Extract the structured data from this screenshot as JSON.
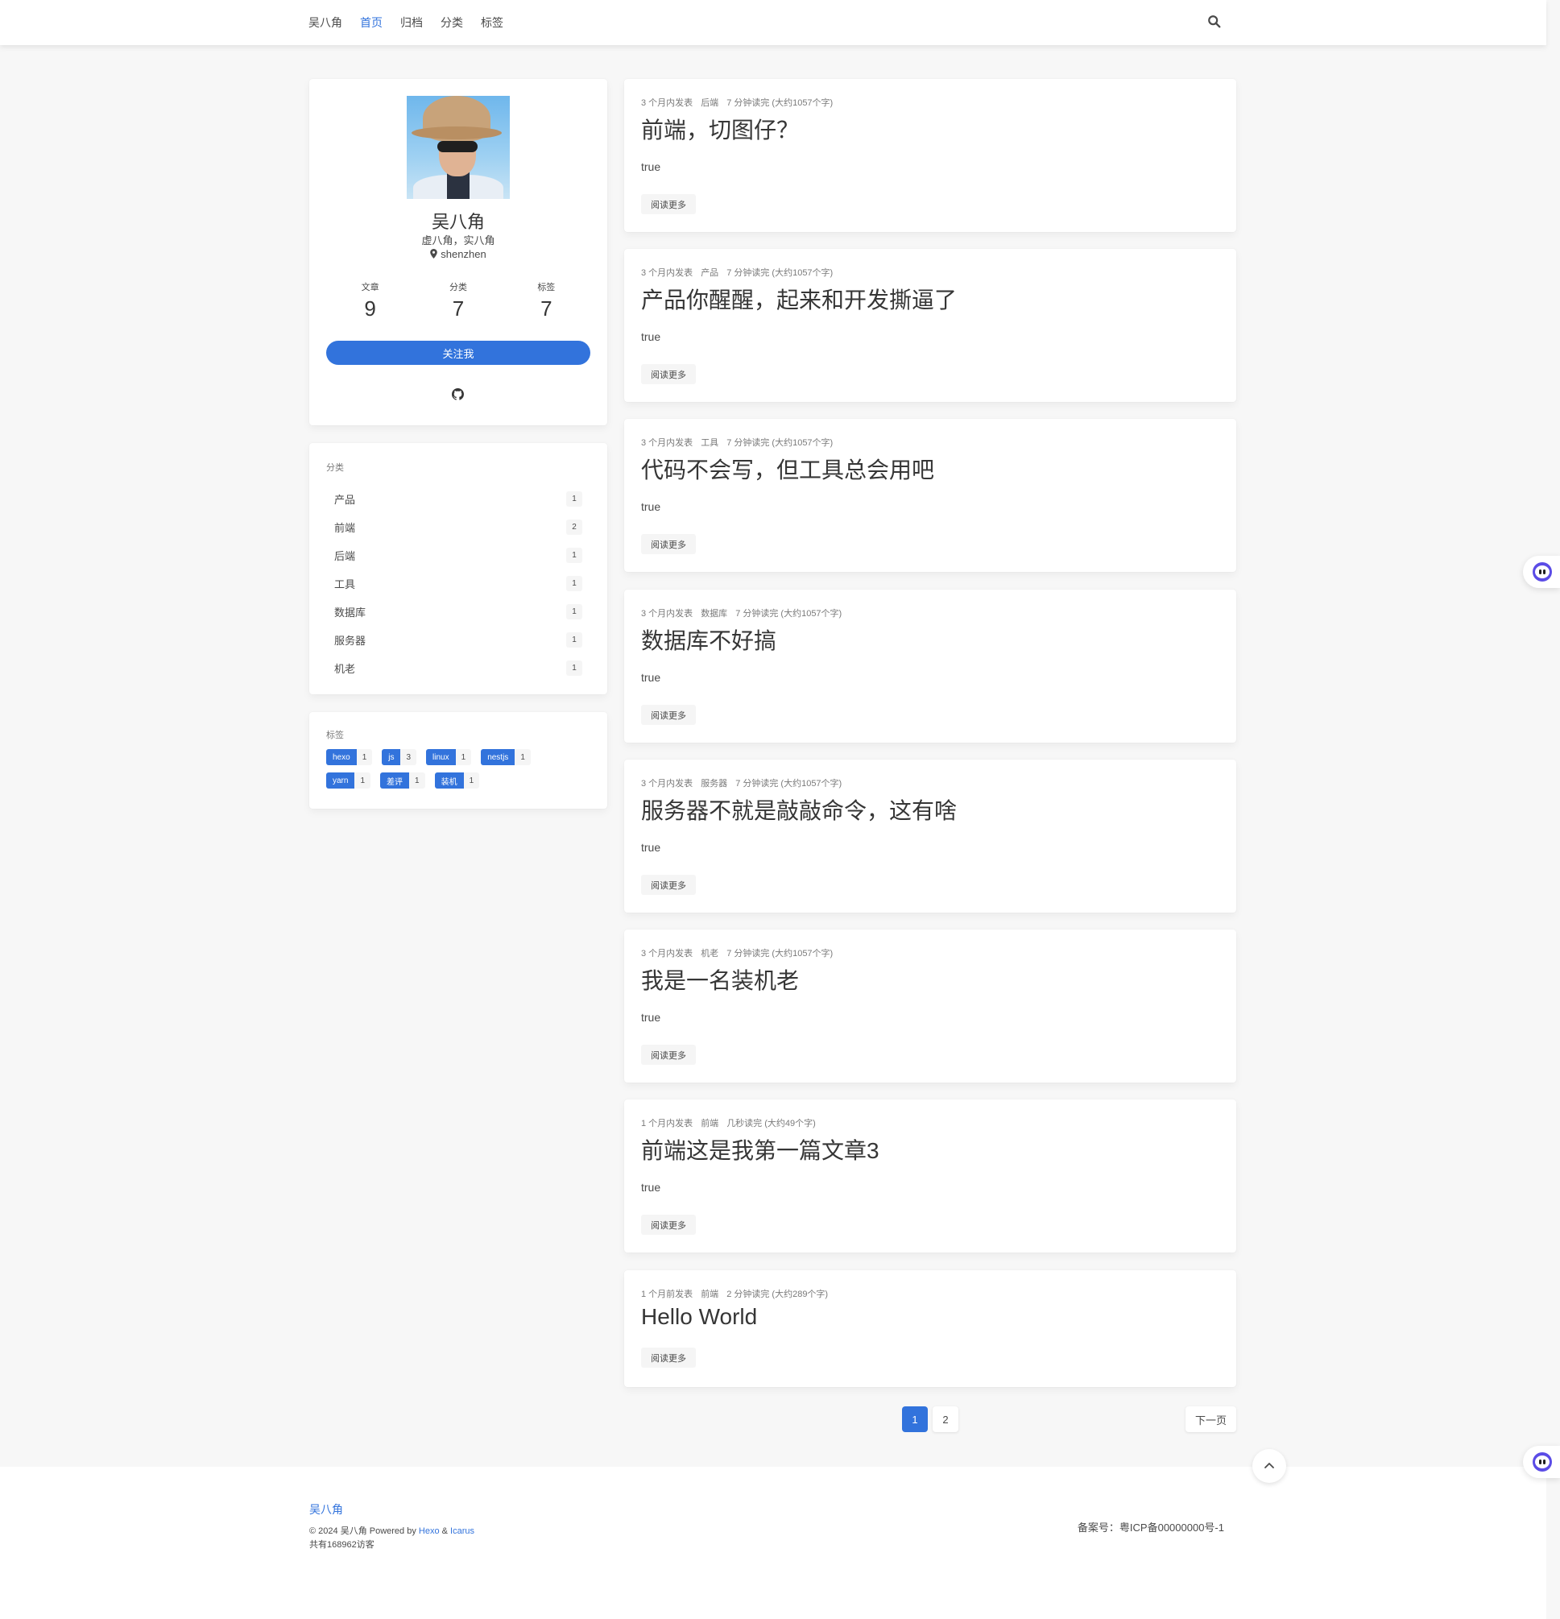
{
  "nav": {
    "brand": "吴八角",
    "items": [
      "首页",
      "归档",
      "分类",
      "标签"
    ],
    "active_index": 0,
    "search_icon": "search-icon"
  },
  "profile": {
    "name": "吴八角",
    "motto": "虚八角，实八角",
    "location": "shenzhen",
    "stats": [
      {
        "label": "文章",
        "value": "9"
      },
      {
        "label": "分类",
        "value": "7"
      },
      {
        "label": "标签",
        "value": "7"
      }
    ],
    "follow_label": "关注我",
    "social_icon": "github-icon"
  },
  "categories": {
    "title": "分类",
    "items": [
      {
        "label": "产品",
        "count": "1"
      },
      {
        "label": "前端",
        "count": "2"
      },
      {
        "label": "后端",
        "count": "1"
      },
      {
        "label": "工具",
        "count": "1"
      },
      {
        "label": "数据库",
        "count": "1"
      },
      {
        "label": "服务器",
        "count": "1"
      },
      {
        "label": "机老",
        "count": "1"
      }
    ]
  },
  "tags": {
    "title": "标签",
    "items": [
      {
        "name": "hexo",
        "count": "1"
      },
      {
        "name": "js",
        "count": "3"
      },
      {
        "name": "linux",
        "count": "1"
      },
      {
        "name": "nestjs",
        "count": "1"
      },
      {
        "name": "yarn",
        "count": "1"
      },
      {
        "name": "差评",
        "count": "1"
      },
      {
        "name": "装机",
        "count": "1"
      }
    ]
  },
  "posts": [
    {
      "date": "3 个月内发表",
      "category": "后端",
      "read": "7 分钟读完 (大约1057个字)",
      "title": "前端，切图仔？",
      "excerpt": "true",
      "more": "阅读更多"
    },
    {
      "date": "3 个月内发表",
      "category": "产品",
      "read": "7 分钟读完 (大约1057个字)",
      "title": "产品你醒醒，起来和开发撕逼了",
      "excerpt": "true",
      "more": "阅读更多"
    },
    {
      "date": "3 个月内发表",
      "category": "工具",
      "read": "7 分钟读完 (大约1057个字)",
      "title": "代码不会写，但工具总会用吧",
      "excerpt": "true",
      "more": "阅读更多"
    },
    {
      "date": "3 个月内发表",
      "category": "数据库",
      "read": "7 分钟读完 (大约1057个字)",
      "title": "数据库不好搞",
      "excerpt": "true",
      "more": "阅读更多"
    },
    {
      "date": "3 个月内发表",
      "category": "服务器",
      "read": "7 分钟读完 (大约1057个字)",
      "title": "服务器不就是敲敲命令，这有啥",
      "excerpt": "true",
      "more": "阅读更多"
    },
    {
      "date": "3 个月内发表",
      "category": "机老",
      "read": "7 分钟读完 (大约1057个字)",
      "title": "我是一名装机老",
      "excerpt": "true",
      "more": "阅读更多"
    },
    {
      "date": "1 个月内发表",
      "category": "前端",
      "read": "几秒读完 (大约49个字)",
      "title": "前端这是我第一篇文章3",
      "excerpt": "true",
      "more": "阅读更多"
    },
    {
      "date": "1 个月前发表",
      "category": "前端",
      "read": "2 分钟读完 (大约289个字)",
      "title": "Hello World",
      "excerpt": "",
      "more": "阅读更多"
    }
  ],
  "pagination": {
    "pages": [
      "1",
      "2"
    ],
    "current": "1",
    "next_label": "下一页"
  },
  "footer": {
    "brand": "吴八角",
    "copyright_prefix": "© 2024 吴八角  Powered by ",
    "hexo": "Hexo",
    "amp": " & ",
    "icarus": "Icarus",
    "visitors": "共有168962访客",
    "icp": "备案号：粤ICP备00000000号-1"
  },
  "colors": {
    "accent": "#3273dc",
    "background": "#f7f7f7",
    "bot": "#5b4ce6"
  }
}
